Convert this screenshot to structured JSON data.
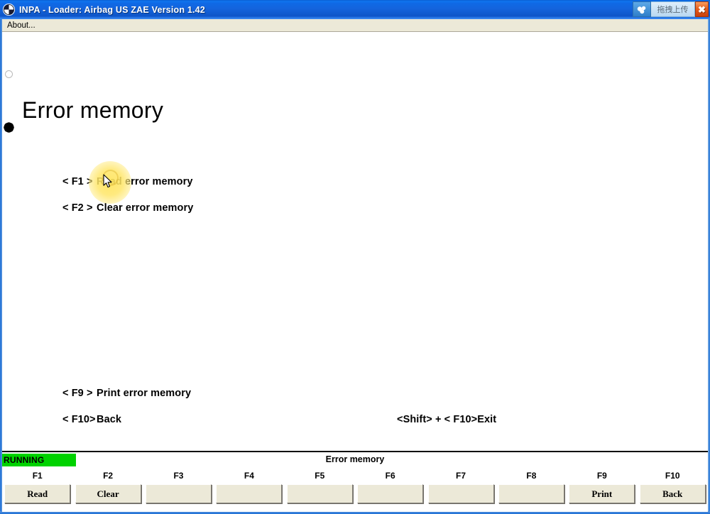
{
  "window": {
    "title": "INPA - Loader:  Airbag US ZAE Version 1.42",
    "logo_icon": "bmw-roundel-icon",
    "close_label": "✖"
  },
  "upload_widget": {
    "cloud_icon": "cloud-upload-icon",
    "label": "拖拽上传"
  },
  "menubar": {
    "items": [
      {
        "label": "About..."
      }
    ]
  },
  "content": {
    "page_title": "Error memory",
    "marker_circle_icon": "hollow-circle-marker-icon",
    "marker_dot_icon": "filled-dot-marker-icon",
    "menu_lines": [
      {
        "key": "< F1 >",
        "label": "Read error memory"
      },
      {
        "key": "< F2 >",
        "label": "Clear error memory"
      },
      {
        "key": "< F9 >",
        "label": "Print error memory"
      },
      {
        "key": "< F10>",
        "label": "Back"
      },
      {
        "key": "<Shift> + < F10>",
        "label": "Exit"
      }
    ],
    "cursor_icon": "arrow-cursor-icon",
    "click_highlight_color": "#ffe45a"
  },
  "statusbar": {
    "running_label": "RUNNING",
    "running_color": "#00d200",
    "title": "Error memory",
    "function_keys": [
      {
        "key": "F1",
        "label": "Read"
      },
      {
        "key": "F2",
        "label": "Clear"
      },
      {
        "key": "F3",
        "label": ""
      },
      {
        "key": "F4",
        "label": ""
      },
      {
        "key": "F5",
        "label": ""
      },
      {
        "key": "F6",
        "label": ""
      },
      {
        "key": "F7",
        "label": ""
      },
      {
        "key": "F8",
        "label": ""
      },
      {
        "key": "F9",
        "label": "Print"
      },
      {
        "key": "F10",
        "label": "Back"
      }
    ]
  }
}
